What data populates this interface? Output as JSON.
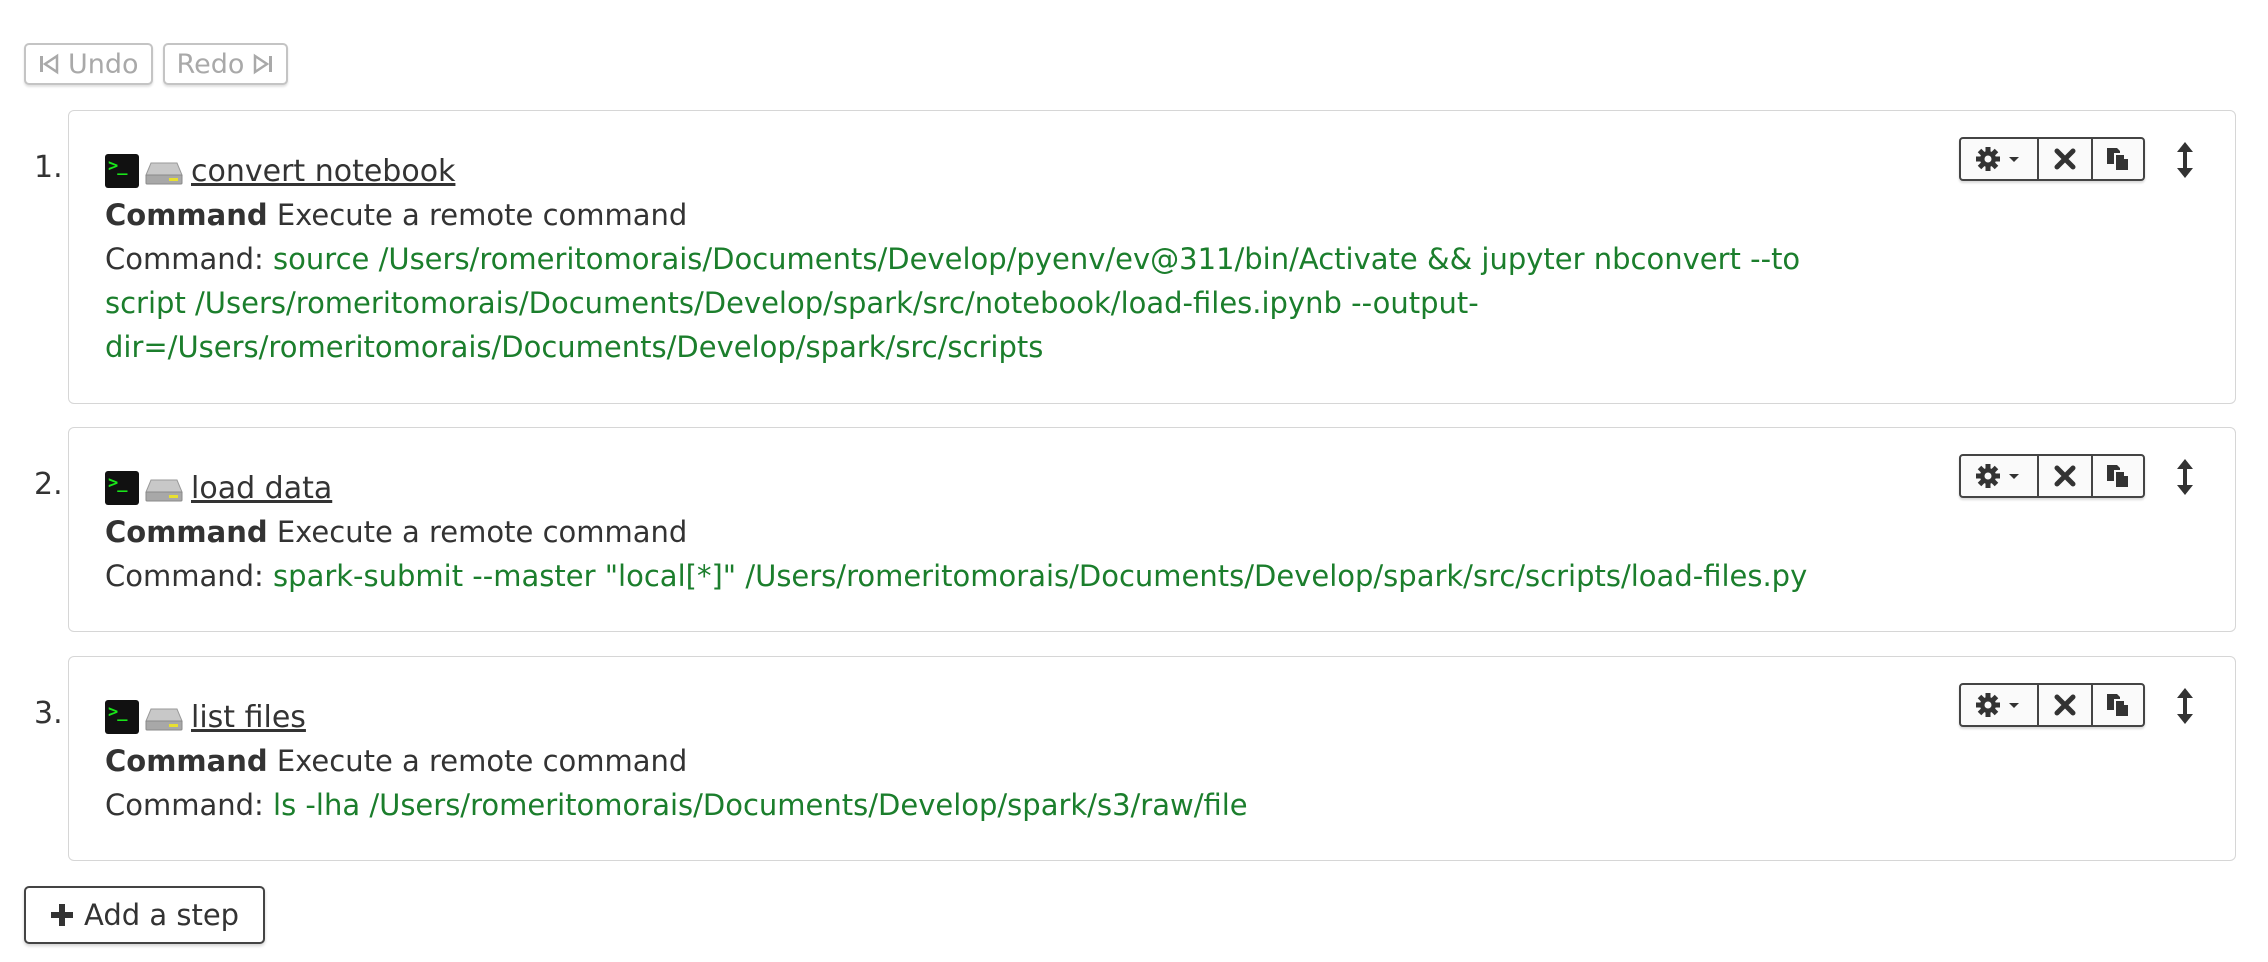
{
  "toolbar": {
    "undo_label": "Undo",
    "redo_label": "Redo"
  },
  "steps": [
    {
      "number": "1.",
      "name": "convert notebook",
      "type_label": "Command",
      "type_desc": "Execute a remote command",
      "command_label": "Command:",
      "command_lines": [
        "source /Users/romeritomorais/Documents/Develop/pyenv/ev@311/bin/Activate && jupyter nbconvert --to",
        "script /Users/romeritomorais/Documents/Develop/spark/src/notebook/load-files.ipynb --output-",
        "dir=/Users/romeritomorais/Documents/Develop/spark/src/scripts"
      ]
    },
    {
      "number": "2.",
      "name": "load data",
      "type_label": "Command",
      "type_desc": "Execute a remote command",
      "command_label": "Command:",
      "command_lines": [
        "spark-submit --master \"local[*]\" /Users/romeritomorais/Documents/Develop/spark/src/scripts/load-files.py"
      ]
    },
    {
      "number": "3.",
      "name": "list files",
      "type_label": "Command",
      "type_desc": "Execute a remote command",
      "command_label": "Command:",
      "command_lines": [
        "ls -lha /Users/romeritomorais/Documents/Develop/spark/s3/raw/file"
      ]
    }
  ],
  "add_step_label": "Add a step",
  "icons": {
    "undo": "skip-back-icon",
    "redo": "skip-forward-icon",
    "terminal": "terminal-icon",
    "drive": "hard-drive-icon",
    "settings": "gear-icon",
    "delete": "close-icon",
    "copy": "copy-icon",
    "move": "vertical-resize-icon",
    "add": "plus-icon"
  },
  "colors": {
    "command_value": "#1b7e2c",
    "terminal_prompt": "#19e619"
  }
}
